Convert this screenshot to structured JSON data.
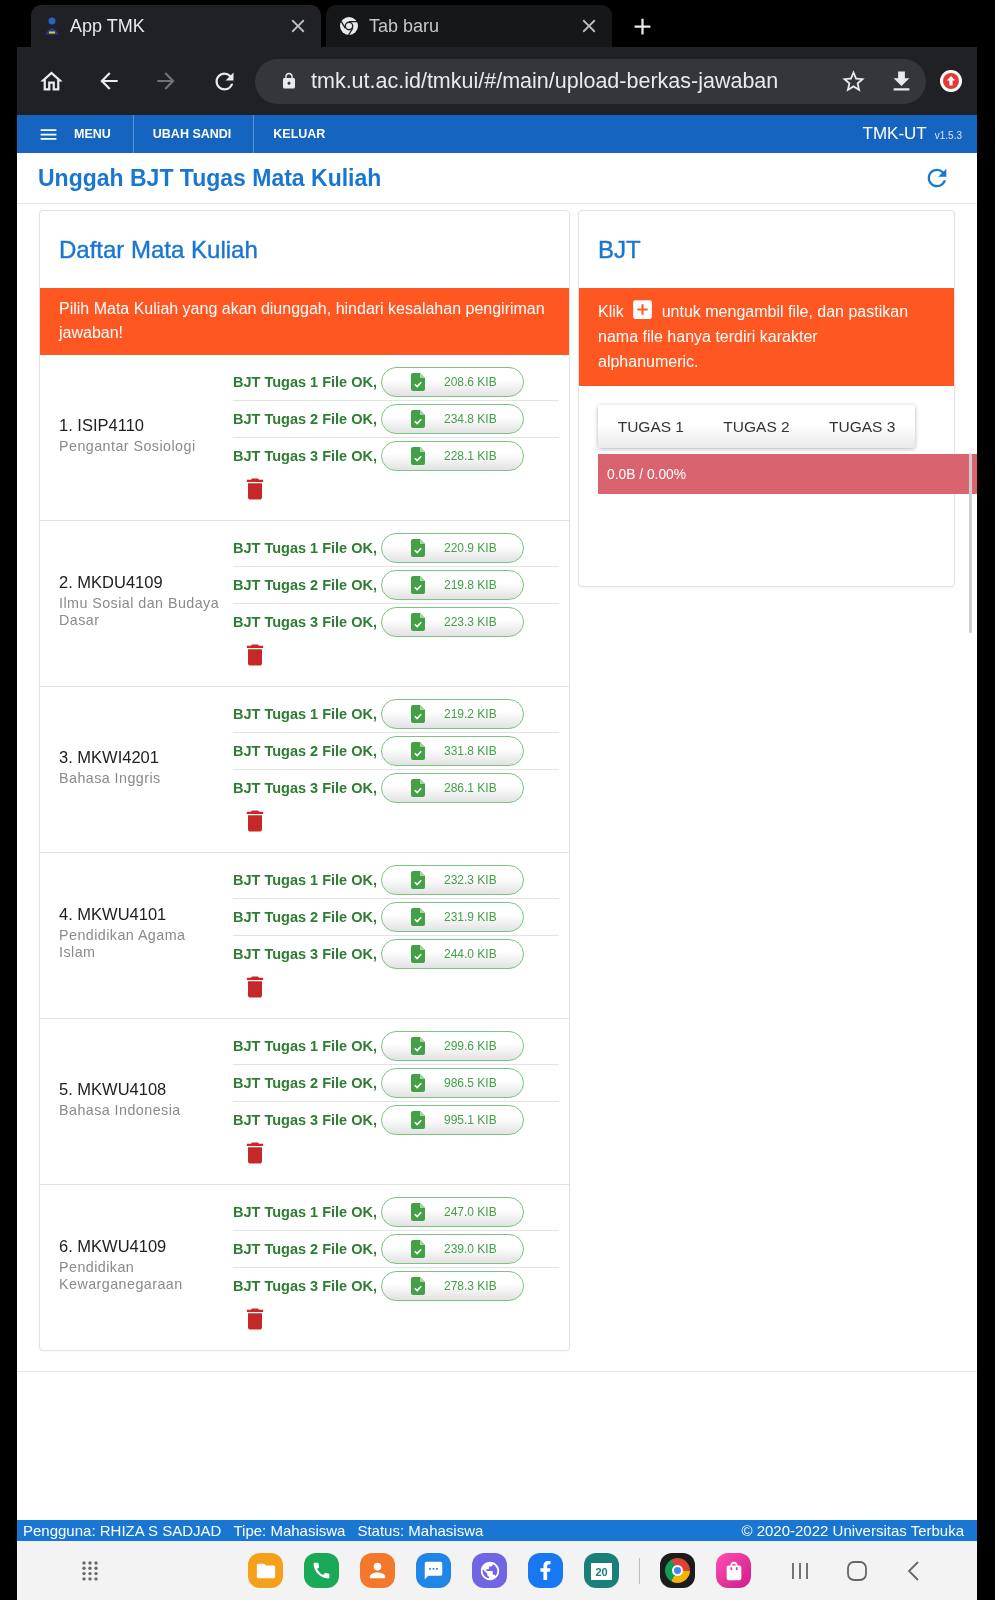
{
  "browser": {
    "tabs": [
      {
        "title": "App TMK",
        "selected": true
      },
      {
        "title": "Tab baru",
        "selected": false
      }
    ],
    "url": "tmk.ut.ac.id/tmkui/#/main/upload-berkas-jawaban"
  },
  "navbar": {
    "items": [
      {
        "label": "MENU",
        "kind": "menu"
      },
      {
        "label": "UBAH SANDI",
        "kind": "link"
      },
      {
        "label": "KELUAR",
        "kind": "link"
      }
    ],
    "brand": "TMK-UT",
    "version": "v1.5.3"
  },
  "page_title": "Unggah BJT Tugas Mata Kuliah",
  "course_panel": {
    "title": "Daftar Mata Kuliah",
    "notice": "Pilih Mata Kuliah yang akan diunggah, hindari kesalahan pengiriman jawaban!",
    "courses": [
      {
        "code": "1. ISIP4110",
        "name": "Pengantar Sosiologi",
        "files": [
          {
            "label": "BJT Tugas 1 File OK,",
            "size": "208.6 KIB"
          },
          {
            "label": "BJT Tugas 2 File OK,",
            "size": "234.8 KIB"
          },
          {
            "label": "BJT Tugas 3 File OK,",
            "size": "228.1 KIB"
          }
        ]
      },
      {
        "code": "2. MKDU4109",
        "name": "Ilmu Sosial dan Budaya Dasar",
        "files": [
          {
            "label": "BJT Tugas 1 File OK,",
            "size": "220.9 KIB"
          },
          {
            "label": "BJT Tugas 2 File OK,",
            "size": "219.8 KIB"
          },
          {
            "label": "BJT Tugas 3 File OK,",
            "size": "223.3 KIB"
          }
        ]
      },
      {
        "code": "3. MKWI4201",
        "name": "Bahasa Inggris",
        "files": [
          {
            "label": "BJT Tugas 1 File OK,",
            "size": "219.2 KIB"
          },
          {
            "label": "BJT Tugas 2 File OK,",
            "size": "331.8 KIB"
          },
          {
            "label": "BJT Tugas 3 File OK,",
            "size": "286.1 KIB"
          }
        ]
      },
      {
        "code": "4. MKWU4101",
        "name": "Pendidikan Agama Islam",
        "files": [
          {
            "label": "BJT Tugas 1 File OK,",
            "size": "232.3 KIB"
          },
          {
            "label": "BJT Tugas 2 File OK,",
            "size": "231.9 KIB"
          },
          {
            "label": "BJT Tugas 3 File OK,",
            "size": "244.0 KIB"
          }
        ]
      },
      {
        "code": "5. MKWU4108",
        "name": "Bahasa Indonesia",
        "files": [
          {
            "label": "BJT Tugas 1 File OK,",
            "size": "299.6 KIB"
          },
          {
            "label": "BJT Tugas 2 File OK,",
            "size": "986.5 KIB"
          },
          {
            "label": "BJT Tugas 3 File OK,",
            "size": "995.1 KIB"
          }
        ]
      },
      {
        "code": "6. MKWU4109",
        "name": "Pendidikan Kewarganegaraan",
        "files": [
          {
            "label": "BJT Tugas 1 File OK,",
            "size": "247.0 KIB"
          },
          {
            "label": "BJT Tugas 2 File OK,",
            "size": "239.0 KIB"
          },
          {
            "label": "BJT Tugas 3 File OK,",
            "size": "278.3 KIB"
          }
        ]
      }
    ]
  },
  "bjt_panel": {
    "title": "BJT",
    "notice": {
      "before": "Klik",
      "after": "untuk mengambil file, dan pastikan nama file hanya terdiri karakter alphanumeric."
    },
    "tabs": [
      {
        "label": "TUGAS 1",
        "selected": false
      },
      {
        "label": "TUGAS 2",
        "selected": false
      },
      {
        "label": "TUGAS 3",
        "selected": false
      }
    ],
    "progress": {
      "reading": "0.0B / 0.00%",
      "level": 0
    }
  },
  "status_bar": {
    "items": [
      "Pengguna: RHIZA S SADJAD",
      "Tipe: Mahasiswa",
      "Status: Mahasiswa"
    ],
    "copyright": "© 2020-2022 Universitas Terbuka"
  },
  "android_nav": {
    "calendar_date": "20"
  }
}
